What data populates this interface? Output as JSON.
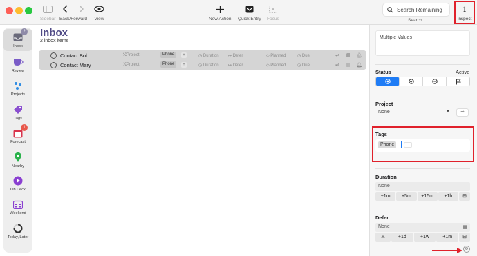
{
  "toolbar": {
    "sidebar_label": "Sidebar",
    "back_forward_label": "Back/Forward",
    "view_label": "View",
    "new_action_label": "New Action",
    "quick_entry_label": "Quick Entry",
    "focus_label": "Focus",
    "search_placeholder": "Search Remaining",
    "search_label": "Search",
    "inspect_glyph": "i",
    "inspect_label": "Inspect"
  },
  "sidebar": {
    "items": [
      {
        "label": "Inbox",
        "icon": "inbox-icon",
        "badge": "2",
        "active": true
      },
      {
        "label": "Review",
        "icon": "coffee-cup-icon"
      },
      {
        "label": "Projects",
        "icon": "projects-icon"
      },
      {
        "label": "Tags",
        "icon": "tag-icon"
      },
      {
        "label": "Forecast",
        "icon": "calendar-icon",
        "badge": "1"
      },
      {
        "label": "Nearby",
        "icon": "location-pin-icon"
      },
      {
        "label": "On Deck",
        "icon": "play-icon"
      },
      {
        "label": "Weekend",
        "icon": "weekend-calendar-icon"
      },
      {
        "label": "Today, Later",
        "icon": "progress-ring-icon"
      }
    ]
  },
  "main": {
    "title": "Inbox",
    "subtitle": "2 inbox items",
    "rows": [
      {
        "name": "Contact Bob",
        "project": "Project",
        "tag": "Phone",
        "tag_add": "+",
        "duration": "Duration",
        "defer": "Defer",
        "planned": "Planned",
        "due": "Due"
      },
      {
        "name": "Contact Mary",
        "project": "Project",
        "tag": "Phone",
        "tag_add": "+",
        "duration": "Duration",
        "defer": "Defer",
        "planned": "Planned",
        "due": "Due"
      }
    ]
  },
  "inspector": {
    "multiple_values": "Multiple Values",
    "status_heading": "Status",
    "status_value": "Active",
    "project_heading": "Project",
    "project_value": "None",
    "tags_heading": "Tags",
    "tag_value": "Phone",
    "duration_heading": "Duration",
    "duration_value": "None",
    "duration_buttons": [
      "+1m",
      "+5m",
      "+15m",
      "+1h"
    ],
    "defer_heading": "Defer",
    "defer_value": "None",
    "defer_buttons": [
      "+1d",
      "+1w",
      "+1m"
    ]
  },
  "colors": {
    "accent": "#1f7cf5",
    "highlight": "#e0212b",
    "title": "#4f4a86"
  }
}
